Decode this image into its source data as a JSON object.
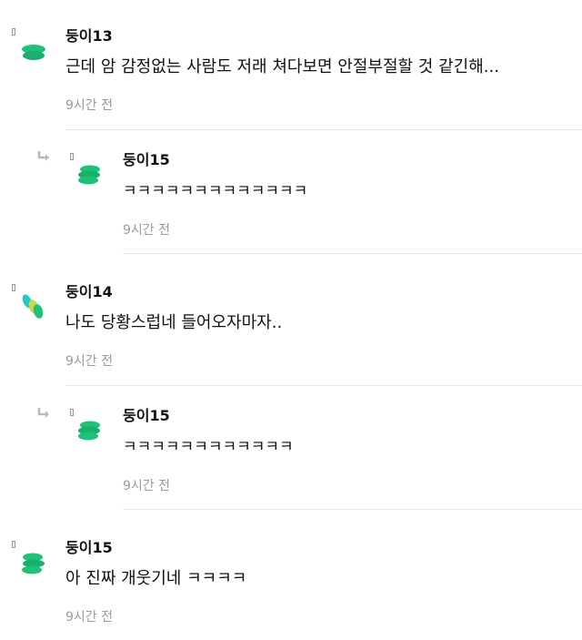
{
  "colors": {
    "accent_green": "#1fc179",
    "accent_teal": "#22c7c7",
    "accent_yellow": "#c4db4a",
    "meta_gray": "#9a9a9a",
    "divider": "#e9e9e9"
  },
  "comments": [
    {
      "nickname": "둥이13",
      "text": "근데 암 감정없는 사람도 저래 쳐다보면 안절부절할 것 같긴해...",
      "time": "9시간 전",
      "avatar_icon": "green-disc-stack-icon"
    },
    {
      "nickname": "둥이15",
      "text": "ㅋㅋㅋㅋㅋㅋㅋㅋㅋㅋㅋㅋㅋ",
      "time": "9시간 전",
      "avatar_icon": "green-disc-stack-icon",
      "reply": true
    },
    {
      "nickname": "둥이14",
      "text": "나도 당황스럽네 들어오자마자..",
      "time": "9시간 전",
      "avatar_icon": "multicolor-ovals-icon"
    },
    {
      "nickname": "둥이15",
      "text": "ㅋㅋㅋㅋㅋㅋㅋㅋㅋㅋㅋㅋ",
      "time": "9시간 전",
      "avatar_icon": "green-disc-stack-icon",
      "reply": true
    },
    {
      "nickname": "둥이15",
      "text": "아 진짜 개웃기네 ㅋㅋㅋㅋ",
      "time": "9시간 전",
      "avatar_icon": "green-disc-stack-icon"
    }
  ]
}
